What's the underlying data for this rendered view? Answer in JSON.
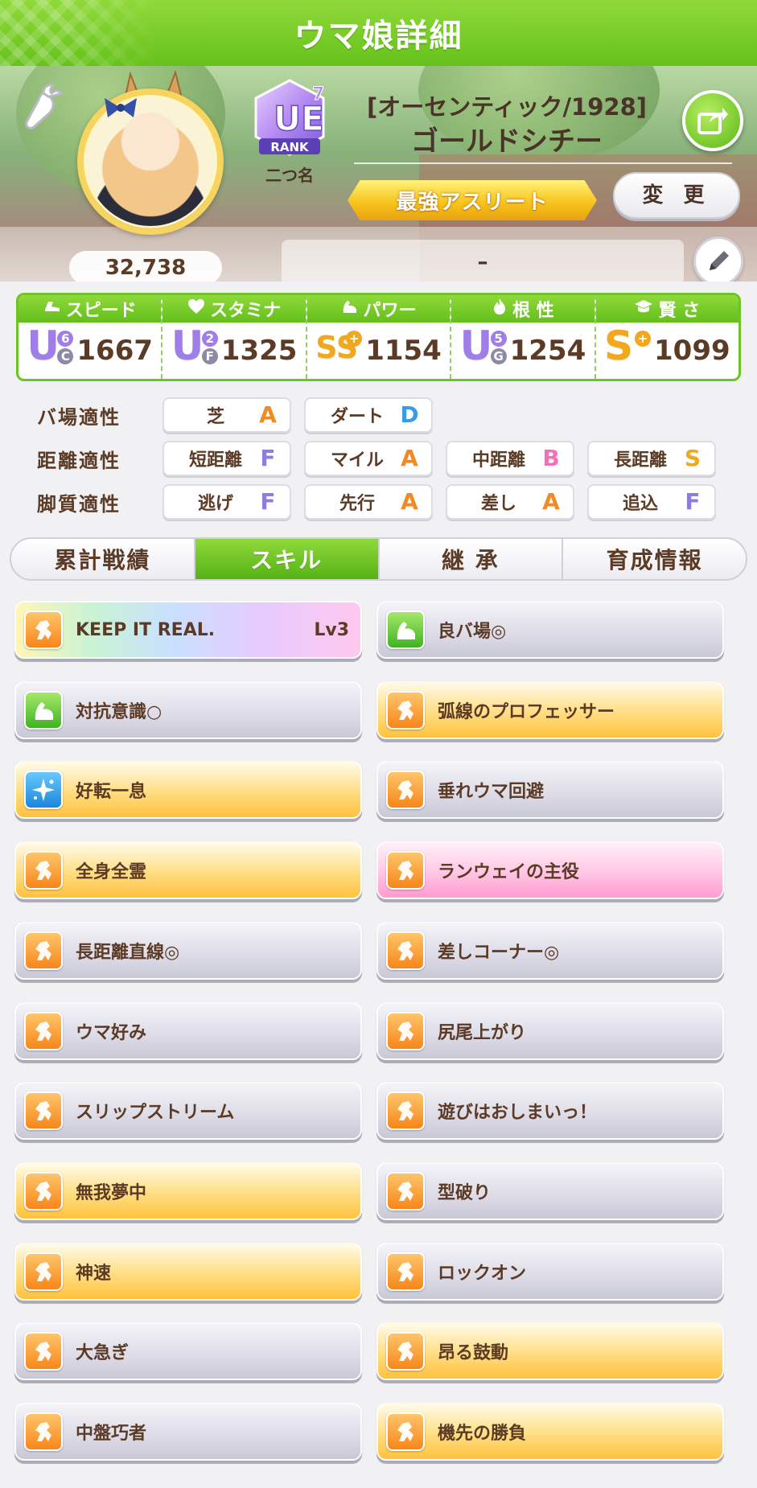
{
  "header": {
    "title": "ウマ娘詳細"
  },
  "profile": {
    "fan_count": "32,738",
    "rank": {
      "badge_text": "UE",
      "badge_number": "7",
      "badge_rank": "RANK",
      "label": "二つ名"
    },
    "outfit": "[オーセンティック/1928]",
    "name": "ゴールドシチー",
    "title": "最強アスリート",
    "change_label": "変 更",
    "memo": "–"
  },
  "stats": [
    {
      "label": "スピード",
      "icon": "speed-shoe-icon",
      "grade": "U",
      "grade_sub": "6",
      "grade_sub2": "C",
      "value": "1667"
    },
    {
      "label": "スタミナ",
      "icon": "heart-icon",
      "grade": "U",
      "grade_sub": "2",
      "grade_sub2": "F",
      "value": "1325"
    },
    {
      "label": "パワー",
      "icon": "muscle-arm-icon",
      "grade": "SS",
      "grade_sub": "+",
      "grade_sub2": "",
      "value": "1154"
    },
    {
      "label": "根 性",
      "icon": "flame-icon",
      "grade": "U",
      "grade_sub": "5",
      "grade_sub2": "G",
      "value": "1254"
    },
    {
      "label": "賢 さ",
      "icon": "mortarboard-icon",
      "grade": "S",
      "grade_sub": "+",
      "grade_sub2": "",
      "value": "1099"
    }
  ],
  "aptitude": {
    "track": {
      "label": "バ場適性",
      "items": [
        {
          "name": "芝",
          "grade": "A"
        },
        {
          "name": "ダート",
          "grade": "D"
        }
      ]
    },
    "distance": {
      "label": "距離適性",
      "items": [
        {
          "name": "短距離",
          "grade": "F"
        },
        {
          "name": "マイル",
          "grade": "A"
        },
        {
          "name": "中距離",
          "grade": "B"
        },
        {
          "name": "長距離",
          "grade": "S"
        }
      ]
    },
    "style": {
      "label": "脚質適性",
      "items": [
        {
          "name": "逃げ",
          "grade": "F"
        },
        {
          "name": "先行",
          "grade": "A"
        },
        {
          "name": "差し",
          "grade": "A"
        },
        {
          "name": "追込",
          "grade": "F"
        }
      ]
    }
  },
  "tabs": [
    {
      "label": "累計戦績"
    },
    {
      "label": "スキル"
    },
    {
      "label": "継 承"
    },
    {
      "label": "育成情報"
    }
  ],
  "skills": [
    {
      "name": "KEEP IT REAL.",
      "level": "Lv3"
    },
    {
      "name": "良バ場◎",
      "level": ""
    },
    {
      "name": "対抗意識○",
      "level": ""
    },
    {
      "name": "弧線のプロフェッサー",
      "level": ""
    },
    {
      "name": "好転一息",
      "level": ""
    },
    {
      "name": "垂れウマ回避",
      "level": ""
    },
    {
      "name": "全身全霊",
      "level": ""
    },
    {
      "name": "ランウェイの主役",
      "level": ""
    },
    {
      "name": "長距離直線◎",
      "level": ""
    },
    {
      "name": "差しコーナー◎",
      "level": ""
    },
    {
      "name": "ウマ好み",
      "level": ""
    },
    {
      "name": "尻尾上がり",
      "level": ""
    },
    {
      "name": "スリップストリーム",
      "level": ""
    },
    {
      "name": "遊びはおしまいっ！",
      "level": ""
    },
    {
      "name": "無我夢中",
      "level": ""
    },
    {
      "name": "型破り",
      "level": ""
    },
    {
      "name": "神速",
      "level": ""
    },
    {
      "name": "ロックオン",
      "level": ""
    },
    {
      "name": "大急ぎ",
      "level": ""
    },
    {
      "name": "昂る鼓動",
      "level": ""
    },
    {
      "name": "中盤巧者",
      "level": ""
    },
    {
      "name": "機先の勝負",
      "level": ""
    }
  ],
  "colors": {
    "accent_green": "#66c21a",
    "grade_U": "#a07ee8",
    "grade_S": "#f2a81e",
    "grade_A": "#f08a24",
    "grade_B": "#f46fb6",
    "grade_D": "#3a9be8",
    "grade_F": "#8a7fe0"
  }
}
